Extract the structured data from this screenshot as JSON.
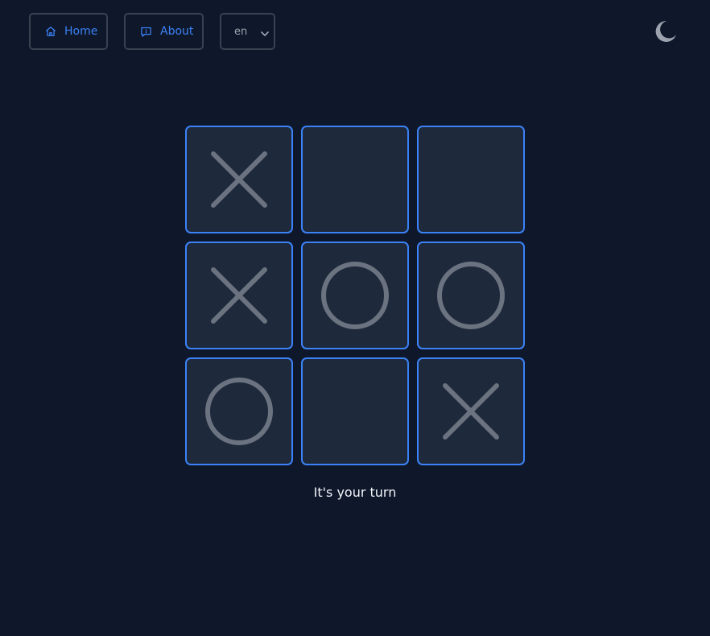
{
  "nav": {
    "home_label": "Home",
    "home_icon": "home-icon",
    "about_label": "About",
    "about_icon": "info-chat-icon",
    "language": "en",
    "theme_icon": "moon-icon"
  },
  "board": {
    "cells": [
      "X",
      "",
      "",
      "X",
      "O",
      "O",
      "O",
      "",
      "X"
    ]
  },
  "status": "It's your turn",
  "colors": {
    "background": "#0f172a",
    "cell_bg": "#1e293b",
    "cell_border": "#3b82f6",
    "mark": "#6b7280",
    "accent": "#3b82f6"
  }
}
